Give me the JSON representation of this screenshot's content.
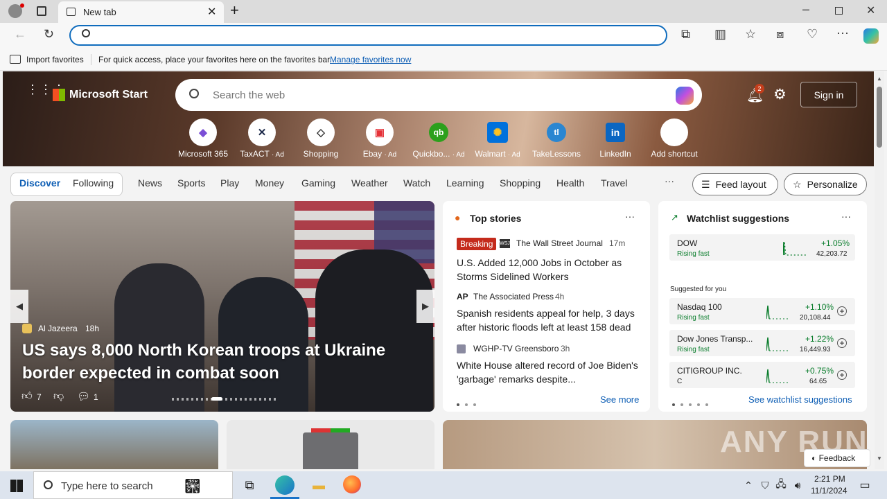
{
  "browser": {
    "tab_title": "New tab",
    "address_placeholder": "",
    "favbar": {
      "import": "Import favorites",
      "hint": "For quick access, place your favorites here on the favorites bar.",
      "manage": "Manage favorites now"
    }
  },
  "header": {
    "brand": "Microsoft Start",
    "search_placeholder": "Search the web",
    "notif_count": "2",
    "sign_in": "Sign in"
  },
  "shortcuts": [
    {
      "label": "Microsoft 365",
      "ad": "",
      "glyph": "◆",
      "color": "#7b4fd6"
    },
    {
      "label": "TaxACT",
      "ad": "· Ad",
      "glyph": "✕",
      "color": "#1d2a4a"
    },
    {
      "label": "Shopping",
      "ad": "",
      "glyph": "◇",
      "color": "#333"
    },
    {
      "label": "Ebay",
      "ad": "· Ad",
      "glyph": "▣",
      "color": "#e53238"
    },
    {
      "label": "Quickbo...",
      "ad": "· Ad",
      "glyph": "qb",
      "color": "#2ca01c"
    },
    {
      "label": "Walmart",
      "ad": "· Ad",
      "glyph": "✺",
      "color": "#0071dc"
    },
    {
      "label": "TakeLessons",
      "ad": "",
      "glyph": "tl",
      "color": "#2a86d1"
    },
    {
      "label": "LinkedIn",
      "ad": "",
      "glyph": "in",
      "color": "#0a66c2"
    },
    {
      "label": "Add shortcut",
      "ad": "",
      "glyph": "+",
      "color": "#333"
    }
  ],
  "nav": {
    "discover": "Discover",
    "following": "Following",
    "items": [
      "News",
      "Sports",
      "Play",
      "Money",
      "Gaming",
      "Weather",
      "Watch",
      "Learning",
      "Shopping",
      "Health",
      "Travel"
    ],
    "more": "···",
    "feed_layout": "Feed layout",
    "personalize": "Personalize"
  },
  "hero_story": {
    "source": "Al Jazeera",
    "age": "18h",
    "headline": "US says 8,000 North Korean troops at Ukraine border expected in combat soon",
    "likes": "7",
    "comments": "1"
  },
  "top_stories": {
    "title": "Top stories",
    "items": [
      {
        "badge": "Breaking",
        "source": "The Wall Street Journal",
        "age": "17m",
        "headline": "U.S. Added 12,000 Jobs in October as Storms Sidelined Workers"
      },
      {
        "badge": "",
        "source": "The Associated Press",
        "age": "4h",
        "headline": "Spanish residents appeal for help, 3 days after historic floods left at least 158 dead"
      },
      {
        "badge": "",
        "source": "WGHP-TV Greensboro",
        "age": "3h",
        "headline": "White House altered record of Joe Biden's 'garbage' remarks despite..."
      }
    ],
    "see_more": "See more"
  },
  "watchlist": {
    "title": "Watchlist suggestions",
    "suggested": "Suggested for you",
    "see_more": "See watchlist suggestions",
    "rows": [
      {
        "name": "DOW",
        "status": "Rising fast",
        "change": "+1.05%",
        "price": "42,203.72"
      },
      {
        "name": "Nasdaq 100",
        "status": "Rising fast",
        "change": "+1.10%",
        "price": "20,108.44"
      },
      {
        "name": "Dow Jones Transp...",
        "status": "Rising fast",
        "change": "+1.22%",
        "price": "16,449.93"
      },
      {
        "name": "CITIGROUP INC.",
        "status": "C",
        "change": "+0.75%",
        "price": "64.65"
      }
    ]
  },
  "feedback": "Feedback",
  "watermark": "ANY RUN",
  "taskbar": {
    "search": "Type here to search",
    "time": "2:21 PM",
    "date": "11/1/2024"
  }
}
